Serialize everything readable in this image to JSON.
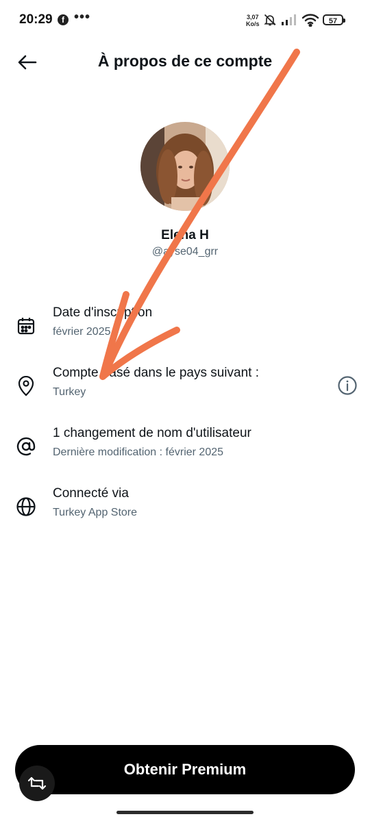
{
  "status_bar": {
    "time": "20:29",
    "notification_icon": "facebook-icon",
    "more": "•••",
    "speed_value": "3,07",
    "speed_unit": "Ko/s",
    "battery": "57"
  },
  "header": {
    "title": "À propos de ce compte",
    "back_icon": "arrow-left-icon"
  },
  "profile": {
    "display_name": "Elena H",
    "handle": "@ayse04_grr"
  },
  "rows": [
    {
      "icon": "calendar-icon",
      "title": "Date d'inscription",
      "subtitle": "février 2025"
    },
    {
      "icon": "location-pin-icon",
      "title": "Compte basé dans le pays suivant :",
      "subtitle": "Turkey",
      "action_icon": "info-icon"
    },
    {
      "icon": "at-sign-icon",
      "title": "1 changement de nom d'utilisateur",
      "subtitle": "Dernière modification : février 2025"
    },
    {
      "icon": "globe-icon",
      "title": "Connecté via",
      "subtitle": "Turkey App Store"
    }
  ],
  "premium_button": {
    "label": "Obtenir Premium"
  },
  "colors": {
    "primary_text": "#0f1419",
    "secondary_text": "#536471",
    "button_bg": "#000000",
    "annotation": "#f0764a"
  }
}
